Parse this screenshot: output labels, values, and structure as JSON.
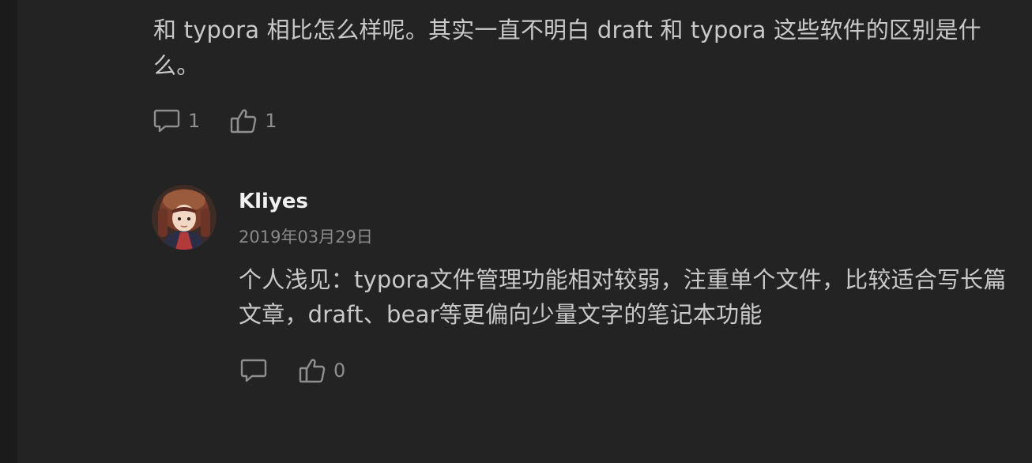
{
  "parent_comment": {
    "text": "和 typora 相比怎么样呢。其实一直不明白 draft 和 typora 这些软件的区别是什么。",
    "reply_count": "1",
    "like_count": "1"
  },
  "reply": {
    "author": "Kliyes",
    "date": "2019年03月29日",
    "text": "个人浅见：typora文件管理功能相对较弱，注重单个文件，比较适合写长篇文章，draft、bear等更偏向少量文字的笔记本功能",
    "like_count": "0"
  },
  "icons": {
    "comment": "comment-bubble-icon",
    "like": "thumbs-up-icon"
  },
  "colors": {
    "background": "#232323",
    "text": "#c9c9c9",
    "muted": "#8f8f8f",
    "author": "#f1f1f1"
  }
}
